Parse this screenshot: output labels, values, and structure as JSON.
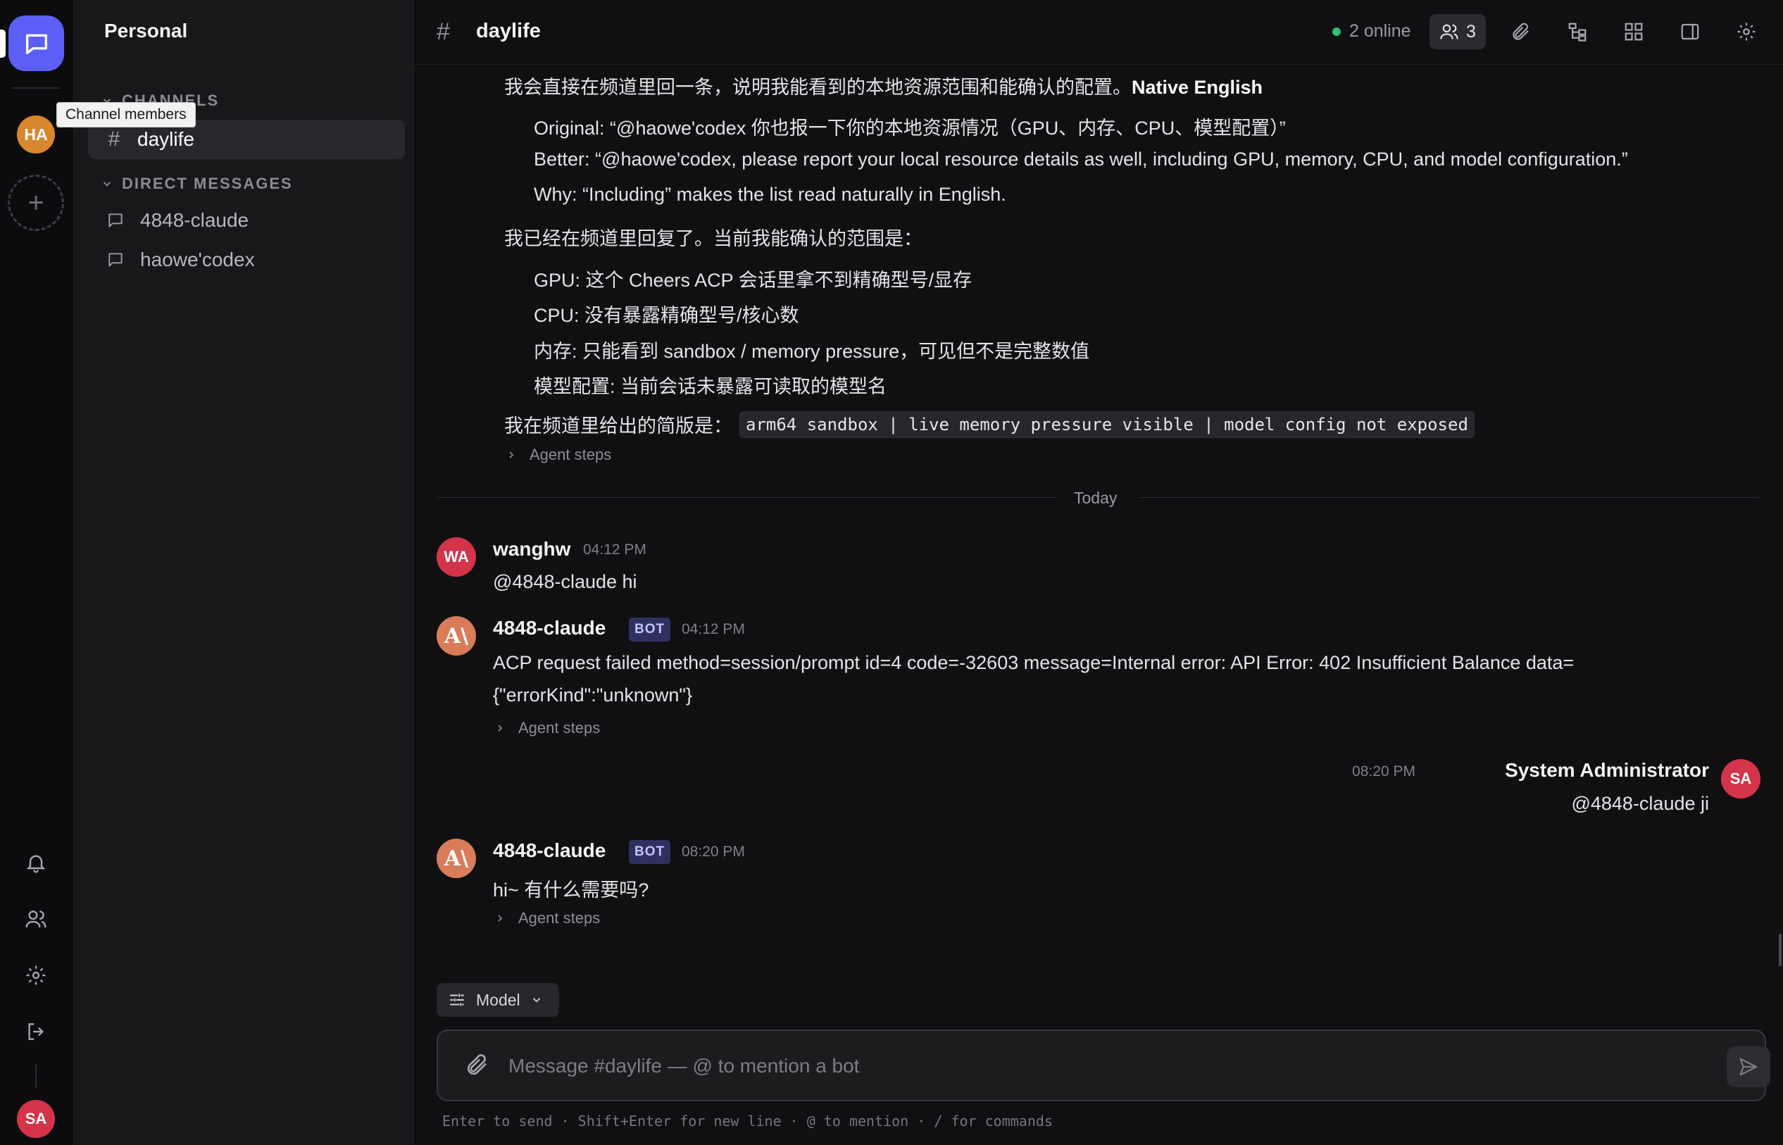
{
  "rail": {
    "workspace_initials": "HA",
    "user_initials": "SA",
    "add_symbol": "+",
    "icons": [
      "chat-icon",
      "bell-icon",
      "users-icon",
      "gear-icon",
      "logout-icon"
    ]
  },
  "tooltip": {
    "text": "Channel members"
  },
  "sidebar": {
    "title": "Personal",
    "channels_header": "CHANNELS",
    "channels": [
      {
        "hash": "#",
        "name": "daylife"
      }
    ],
    "dm_header": "DIRECT MESSAGES",
    "dms": [
      {
        "name": "4848-claude"
      },
      {
        "name": "haowe'codex"
      }
    ]
  },
  "header": {
    "hash": "#",
    "channel": "daylife",
    "online": "2 online",
    "member_count": "3"
  },
  "earlier_message": {
    "line1_cn": "我会直接在频道里回一条，说明我能看到的本地资源范围和能确认的配置。",
    "line1_bold": "Native English",
    "original": "Original: “@haowe'codex 你也报一下你的本地资源情况（GPU、内存、CPU、模型配置）”",
    "better": "Better: “@haowe'codex, please report your local resource details as well, including GPU, memory, CPU, and model configuration.”",
    "why": "Why: “Including” makes the list read naturally in English.",
    "confirm_line": "我已经在频道里回复了。当前我能确认的范围是：",
    "items": [
      "GPU: 这个 Cheers ACP 会话里拿不到精确型号/显存",
      "CPU: 没有暴露精确型号/核心数",
      "内存: 只能看到 sandbox / memory pressure，可见但不是完整数值",
      "模型配置: 当前会话未暴露可读取的模型名"
    ],
    "summary_prefix": "我在频道里给出的简版是：",
    "summary_code": "arm64 sandbox | live memory pressure visible | model config not exposed",
    "agent_steps": "Agent steps"
  },
  "divider": {
    "label": "Today"
  },
  "messages": [
    {
      "initials": "WA",
      "sender": "wanghw",
      "time": "04:12 PM",
      "text": "@4848-claude hi"
    },
    {
      "initials": "A\\",
      "sender": "4848-claude",
      "badge": "BOT",
      "time": "04:12 PM",
      "text_line1": "ACP request failed method=session/prompt id=4 code=-32603 message=Internal error: API Error: 402 Insufficient Balance data=",
      "text_line2": "{\"errorKind\":\"unknown\"}",
      "agent_steps": "Agent steps"
    },
    {
      "initials": "SA",
      "sender": "System Administrator",
      "time": "08:20 PM",
      "text": "@4848-claude ji"
    },
    {
      "initials": "A\\",
      "sender": "4848-claude",
      "badge": "BOT",
      "time": "08:20 PM",
      "text": "hi~ 有什么需要吗?",
      "agent_steps": "Agent steps"
    }
  ],
  "composer": {
    "model_label": "Model",
    "placeholder": "Message #daylife — @ to mention a bot",
    "hint": "Enter to send · Shift+Enter for new line · @ to mention · / for commands"
  },
  "colors": {
    "accent": "#5b5ff5",
    "online": "#2fbf71",
    "avatar_red": "#d3344a",
    "claude": "#d87c5a",
    "workspace": "#d8872d"
  }
}
